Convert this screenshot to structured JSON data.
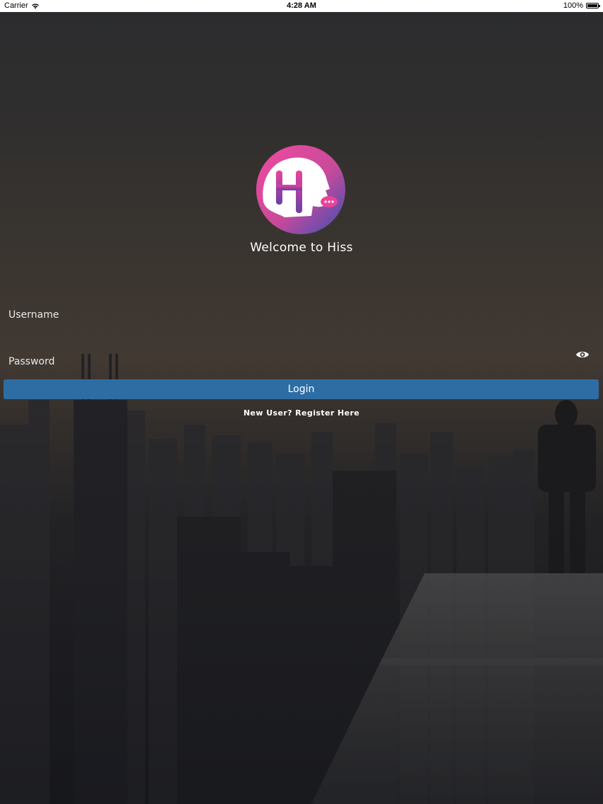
{
  "status_bar": {
    "carrier": "Carrier",
    "time": "4:28 AM",
    "battery": "100%"
  },
  "header": {
    "welcome": "Welcome to Hiss"
  },
  "form": {
    "username_label": "Username",
    "password_label": "Password",
    "login_label": "Login",
    "register_label": "New User? Register Here"
  },
  "colors": {
    "login_button": "#2e6da4",
    "logo_gradient_start": "#e83e8c",
    "logo_gradient_end": "#3a4fb5"
  },
  "icons": {
    "wifi": "wifi-icon",
    "battery": "battery-icon",
    "eye": "eye-icon",
    "logo": "hiss-logo"
  }
}
